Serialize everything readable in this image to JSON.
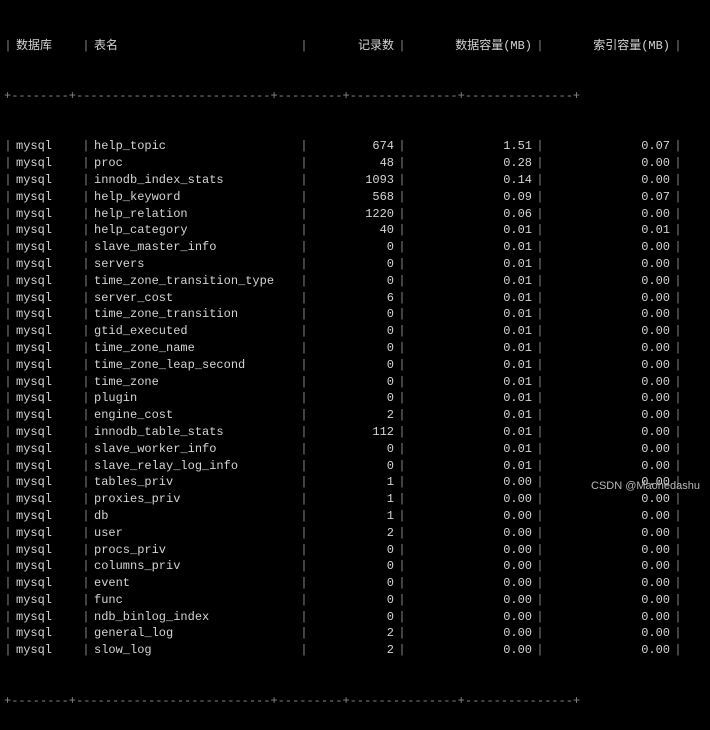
{
  "headers": {
    "db": "数据库",
    "table": "表名",
    "rows": "记录数",
    "data_mb": "数据容量(MB)",
    "idx_mb": "索引容量(MB)"
  },
  "rows": [
    {
      "db": "mysql",
      "table": "help_topic",
      "rows": "674",
      "data": "1.51",
      "idx": "0.07"
    },
    {
      "db": "mysql",
      "table": "proc",
      "rows": "48",
      "data": "0.28",
      "idx": "0.00"
    },
    {
      "db": "mysql",
      "table": "innodb_index_stats",
      "rows": "1093",
      "data": "0.14",
      "idx": "0.00"
    },
    {
      "db": "mysql",
      "table": "help_keyword",
      "rows": "568",
      "data": "0.09",
      "idx": "0.07"
    },
    {
      "db": "mysql",
      "table": "help_relation",
      "rows": "1220",
      "data": "0.06",
      "idx": "0.00"
    },
    {
      "db": "mysql",
      "table": "help_category",
      "rows": "40",
      "data": "0.01",
      "idx": "0.01"
    },
    {
      "db": "mysql",
      "table": "slave_master_info",
      "rows": "0",
      "data": "0.01",
      "idx": "0.00"
    },
    {
      "db": "mysql",
      "table": "servers",
      "rows": "0",
      "data": "0.01",
      "idx": "0.00"
    },
    {
      "db": "mysql",
      "table": "time_zone_transition_type",
      "rows": "0",
      "data": "0.01",
      "idx": "0.00"
    },
    {
      "db": "mysql",
      "table": "server_cost",
      "rows": "6",
      "data": "0.01",
      "idx": "0.00"
    },
    {
      "db": "mysql",
      "table": "time_zone_transition",
      "rows": "0",
      "data": "0.01",
      "idx": "0.00"
    },
    {
      "db": "mysql",
      "table": "gtid_executed",
      "rows": "0",
      "data": "0.01",
      "idx": "0.00"
    },
    {
      "db": "mysql",
      "table": "time_zone_name",
      "rows": "0",
      "data": "0.01",
      "idx": "0.00"
    },
    {
      "db": "mysql",
      "table": "time_zone_leap_second",
      "rows": "0",
      "data": "0.01",
      "idx": "0.00"
    },
    {
      "db": "mysql",
      "table": "time_zone",
      "rows": "0",
      "data": "0.01",
      "idx": "0.00"
    },
    {
      "db": "mysql",
      "table": "plugin",
      "rows": "0",
      "data": "0.01",
      "idx": "0.00"
    },
    {
      "db": "mysql",
      "table": "engine_cost",
      "rows": "2",
      "data": "0.01",
      "idx": "0.00"
    },
    {
      "db": "mysql",
      "table": "innodb_table_stats",
      "rows": "112",
      "data": "0.01",
      "idx": "0.00"
    },
    {
      "db": "mysql",
      "table": "slave_worker_info",
      "rows": "0",
      "data": "0.01",
      "idx": "0.00"
    },
    {
      "db": "mysql",
      "table": "slave_relay_log_info",
      "rows": "0",
      "data": "0.01",
      "idx": "0.00"
    },
    {
      "db": "mysql",
      "table": "tables_priv",
      "rows": "1",
      "data": "0.00",
      "idx": "0.00"
    },
    {
      "db": "mysql",
      "table": "proxies_priv",
      "rows": "1",
      "data": "0.00",
      "idx": "0.00"
    },
    {
      "db": "mysql",
      "table": "db",
      "rows": "1",
      "data": "0.00",
      "idx": "0.00"
    },
    {
      "db": "mysql",
      "table": "user",
      "rows": "2",
      "data": "0.00",
      "idx": "0.00"
    },
    {
      "db": "mysql",
      "table": "procs_priv",
      "rows": "0",
      "data": "0.00",
      "idx": "0.00"
    },
    {
      "db": "mysql",
      "table": "columns_priv",
      "rows": "0",
      "data": "0.00",
      "idx": "0.00"
    },
    {
      "db": "mysql",
      "table": "event",
      "rows": "0",
      "data": "0.00",
      "idx": "0.00"
    },
    {
      "db": "mysql",
      "table": "func",
      "rows": "0",
      "data": "0.00",
      "idx": "0.00"
    },
    {
      "db": "mysql",
      "table": "ndb_binlog_index",
      "rows": "0",
      "data": "0.00",
      "idx": "0.00"
    },
    {
      "db": "mysql",
      "table": "general_log",
      "rows": "2",
      "data": "0.00",
      "idx": "0.00"
    },
    {
      "db": "mysql",
      "table": "slow_log",
      "rows": "2",
      "data": "0.00",
      "idx": "0.00"
    }
  ],
  "watermark": "CSDN @Maohedashu"
}
